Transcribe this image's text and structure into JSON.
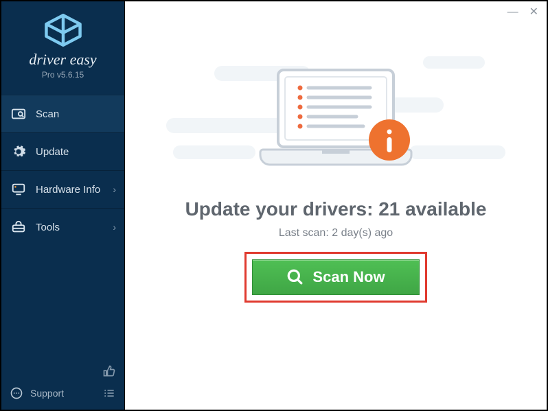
{
  "brand": {
    "name": "driver easy",
    "version": "Pro v5.6.15"
  },
  "sidebar": {
    "items": [
      {
        "label": "Scan",
        "active": true
      },
      {
        "label": "Update",
        "active": false
      },
      {
        "label": "Hardware Info",
        "active": false
      },
      {
        "label": "Tools",
        "active": false
      }
    ],
    "support_label": "Support"
  },
  "main": {
    "headline": "Update your drivers: 21 available",
    "last_scan": "Last scan: 2 day(s) ago",
    "scan_button": "Scan Now"
  }
}
